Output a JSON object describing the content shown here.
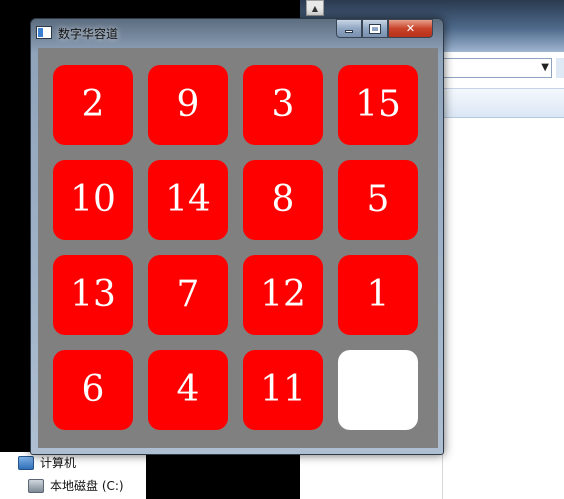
{
  "window": {
    "title": "数字华容道"
  },
  "board": {
    "tile_color": "#ff0000",
    "empty_color": "#ffffff",
    "background_color": "#808080",
    "tiles": [
      [
        "2",
        "9",
        "3",
        "15"
      ],
      [
        "10",
        "14",
        "8",
        "5"
      ],
      [
        "13",
        "7",
        "12",
        "1"
      ],
      [
        "6",
        "4",
        "11",
        ""
      ]
    ]
  },
  "explorer": {
    "nav_items": [
      "计算机",
      "本地磁盘 (C:)"
    ]
  }
}
